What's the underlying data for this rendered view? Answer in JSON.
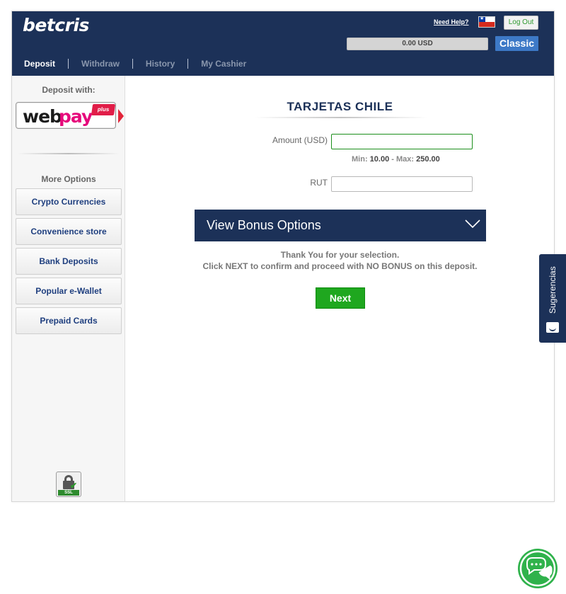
{
  "header": {
    "logo": "betcris",
    "need_help": "Need Help?",
    "logout_label": "Log Out",
    "balance": "0.00 USD",
    "classic_label": "Classic",
    "tabs": [
      {
        "label": "Deposit",
        "active": true
      },
      {
        "label": "Withdraw",
        "active": false
      },
      {
        "label": "History",
        "active": false
      },
      {
        "label": "My Cashier",
        "active": false
      }
    ]
  },
  "sidebar": {
    "deposit_with": "Deposit with:",
    "selected_method": {
      "web": "web",
      "pay": "pay",
      "plus": "plus"
    },
    "more_options": "More Options",
    "options": [
      "Crypto Currencies",
      "Convenience store",
      "Bank Deposits",
      "Popular e-Wallet",
      "Prepaid Cards"
    ],
    "ssl_label": "SSL"
  },
  "main": {
    "title": "TARJETAS CHILE",
    "amount_label": "Amount (USD)",
    "amount_value": "",
    "min_label": "Min:",
    "min_value": "10.00",
    "sep": "-",
    "max_label": "Max:",
    "max_value": "250.00",
    "rut_label": "RUT",
    "rut_value": "",
    "bonus_label": "View Bonus Options",
    "thanks_line1": "Thank You for your selection.",
    "thanks_line2": "Click NEXT to confirm and proceed with NO BONUS on this deposit.",
    "next_label": "Next"
  },
  "feedback": {
    "label": "Sugerencias"
  },
  "colors": {
    "navy": "#1c3158",
    "accent_blue": "#3d79c7",
    "next_green": "#1fa71f",
    "chat_green": "#2fb24b",
    "webpay_pink": "#e6097b"
  }
}
